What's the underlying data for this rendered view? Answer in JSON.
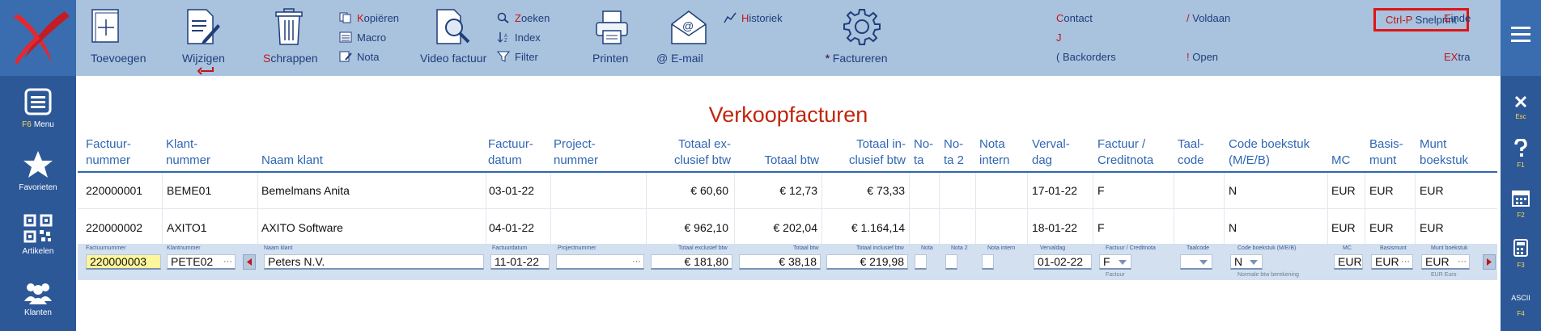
{
  "toolbar": {
    "add": "Toevoegen",
    "edit": "Wijzigen",
    "delete": "Schrappen",
    "copy_hk": "K",
    "copy_rest": "opiëren",
    "macro": "Macro",
    "note": "Nota",
    "video": "Video factuur",
    "search_hk": "Z",
    "search_rest": "oeken",
    "index": "Index",
    "filter": "Filter",
    "print": "Printen",
    "email": "@ E-mail",
    "history_hk": "H",
    "history_rest": "istoriek",
    "invoice": "* Factureren",
    "contact_hk": "C",
    "contact_rest": "ontact",
    "j_label": "J",
    "backorders": "( Backorders",
    "paid_hk": "/",
    "paid_rest": " Voldaan",
    "open_hk": "!",
    "open_rest": " Open",
    "quickprint_hk": "Ctrl-P",
    "quickprint_rest": " Snelprint",
    "end_hk": "E",
    "end_rest": "inde",
    "extra_hk": "EX",
    "extra_rest": "tra"
  },
  "sidebar": {
    "menu_key": "F6",
    "menu_label": "Menu",
    "favorites": "Favorieten",
    "articles": "Artikelen",
    "customers": "Klanten"
  },
  "right_sidebar": {
    "esc": "Esc",
    "f1": "F1",
    "f2": "F2",
    "f3": "F3",
    "ascii": "ASCII",
    "f4": "F4"
  },
  "page_title": "Verkoopfacturen",
  "columns": {
    "invoice_no": [
      "Factuur-",
      "nummer"
    ],
    "customer_no": [
      "Klant-",
      "nummer"
    ],
    "customer_name": [
      "",
      "Naam klant"
    ],
    "invoice_date": [
      "Factuur-",
      "datum"
    ],
    "project_no": [
      "Project-",
      "nummer"
    ],
    "total_excl": [
      "Totaal ex-",
      "clusief btw"
    ],
    "total_vat": [
      "",
      "Totaal btw"
    ],
    "total_incl": [
      "Totaal in-",
      "clusief btw"
    ],
    "note": [
      "No-",
      "ta"
    ],
    "note2": [
      "No-",
      "ta 2"
    ],
    "note_internal": [
      "Nota",
      "intern"
    ],
    "due_day": [
      "Verval-",
      "dag"
    ],
    "invoice_credit": [
      "Factuur /",
      "Creditnota"
    ],
    "lang_code": [
      "Taal-",
      "code"
    ],
    "booking_code": [
      "Code boekstuk",
      "(M/E/B)"
    ],
    "mc": [
      "",
      "MC"
    ],
    "base_currency": [
      "Basis-",
      "munt"
    ],
    "currency_booking": [
      "Munt",
      "boekstuk"
    ]
  },
  "rows": [
    {
      "invoice_no": "220000001",
      "customer_no": "BEME01",
      "customer_name": "Bemelmans Anita",
      "invoice_date": "03-01-22",
      "total_excl": "€ 60,60",
      "total_vat": "€ 12,73",
      "total_incl": "€ 73,33",
      "due_day": "17-01-22",
      "invoice_credit": "F",
      "booking_code": "N",
      "mc": "EUR",
      "base_currency": "EUR",
      "currency_booking": "EUR"
    },
    {
      "invoice_no": "220000002",
      "customer_no": "AXITO1",
      "customer_name": "AXITO Software",
      "invoice_date": "04-01-22",
      "total_excl": "€ 962,10",
      "total_vat": "€ 202,04",
      "total_incl": "€ 1.164,14",
      "due_day": "18-01-22",
      "invoice_credit": "F",
      "booking_code": "N",
      "mc": "EUR",
      "base_currency": "EUR",
      "currency_booking": "EUR"
    }
  ],
  "edit_row": {
    "labels": {
      "invoice_no": "Factuurnummer",
      "customer_no": "Klantnummer",
      "customer_name": "Naam klant",
      "invoice_date": "Factuurdatum",
      "project_no": "Projectnummer",
      "total_excl": "Totaal exclusief btw",
      "total_vat": "Totaal btw",
      "total_incl": "Totaal inclusief btw",
      "note": "Nota",
      "note2": "Nota 2",
      "note_internal": "Nota intern",
      "due_day": "Vervaldag",
      "invoice_credit": "Factuur / Creditnota",
      "lang_code": "Taalcode",
      "booking_code": "Code boekstuk (M/E/B)",
      "mc": "MC",
      "base_currency": "Basismunt",
      "currency_booking": "Munt boekstuk"
    },
    "values": {
      "invoice_no": "220000003",
      "customer_no": "PETE02",
      "customer_name": "Peters N.V.",
      "invoice_date": "11-01-22",
      "project_no": "",
      "total_excl": "€ 181,80",
      "total_vat": "€ 38,18",
      "total_incl": "€ 219,98",
      "due_day": "01-02-22",
      "invoice_credit": "F",
      "booking_code": "N",
      "mc": "EUR",
      "base_currency": "EUR",
      "currency_booking": "EUR"
    },
    "subs": {
      "invoice_credit": "Factuur",
      "booking_code": "Normale btw berekening",
      "currency_booking": "EUR Euro"
    }
  },
  "colors": {
    "accent": "#2d5898",
    "toolbar": "#a9c2de",
    "title": "#c0260e",
    "header_text": "#2f66b3",
    "highlight": "#fff59a",
    "quickprint_border": "#e01414"
  }
}
